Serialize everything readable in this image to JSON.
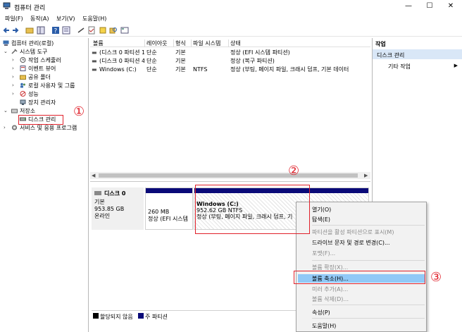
{
  "window": {
    "title": "컴퓨터 관리",
    "controls": {
      "minimize": "—",
      "maximize": "☐",
      "close": "✕"
    }
  },
  "menu": [
    "파일(F)",
    "동작(A)",
    "보기(V)",
    "도움말(H)"
  ],
  "tree": {
    "root": "컴퓨터 관리(로컬)",
    "system_tools": "시스템 도구",
    "task_scheduler": "작업 스케줄러",
    "event_viewer": "이벤트 뷰어",
    "shared_folders": "공유 폴더",
    "local_users": "로컬 사용자 및 그룹",
    "performance": "성능",
    "device_manager": "장치 관리자",
    "storage": "저장소",
    "disk_management": "디스크 관리",
    "services": "서비스 및 응용 프로그램"
  },
  "volumes": {
    "headers": [
      "볼륨",
      "레이아웃",
      "형식",
      "파일 시스템",
      "상태"
    ],
    "rows": [
      [
        "(디스크 0 파티션 1)",
        "단순",
        "기본",
        "",
        "정상 (EFI 시스템 파티션)"
      ],
      [
        "(디스크 0 파티션 4)",
        "단순",
        "기본",
        "",
        "정상 (복구 파티션)"
      ],
      [
        "Windows (C:)",
        "단순",
        "기본",
        "NTFS",
        "정상 (부팅, 페이지 파일, 크래시 덤프, 기본 데이터"
      ]
    ]
  },
  "disk": {
    "name": "디스크 0",
    "type": "기본",
    "size": "953.85 GB",
    "status": "온라인",
    "part1_size": "260 MB",
    "part1_status": "정상 (EFI 시스템",
    "part2_name": "Windows (C:)",
    "part2_size": "952.62 GB NTFS",
    "part2_status": "정상 (부팅, 페이지 파일, 크래시 덤프, 기"
  },
  "legend": {
    "unallocated": "할당되지 않음",
    "primary": "주 파티션"
  },
  "actions": {
    "header": "작업",
    "section": "디스크 관리",
    "more": "기타 작업"
  },
  "context_menu": {
    "open": "열기(O)",
    "explore": "탐색(E)",
    "mark_active": "파티션을 활성 파티션으로 표시(M)",
    "change_letter": "드라이브 문자 및 경로 변경(C)...",
    "format": "포맷(F)...",
    "extend": "볼륨 확장(X)...",
    "shrink": "볼륨 축소(H)...",
    "add_mirror": "미러 추가(A)...",
    "delete": "볼륨 삭제(D)...",
    "properties": "속성(P)",
    "help": "도움말(H)"
  },
  "annotations": [
    "①",
    "②",
    "③"
  ],
  "colors": {
    "primary_partition": "#0a0a78",
    "highlight": "#91c9f7",
    "annotation": "#e0202a"
  }
}
